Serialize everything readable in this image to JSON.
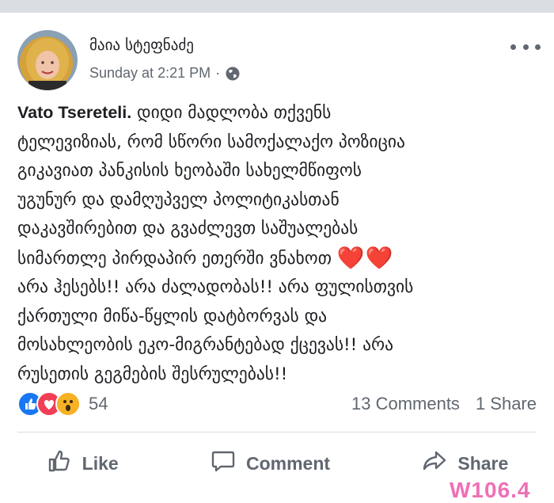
{
  "post": {
    "author": "მაია სტეფნაძე",
    "timestamp": "Sunday at 2:21 PM",
    "separator": "·",
    "privacy_icon": "globe-icon",
    "text_name": "Vato Tsereteli.",
    "text_body": " დიდი მადლობა თქვენს\nტელევიზიას, რომ სწორი სამოქალაქო პოზიცია\nგიკავიათ პანკისის ხეობაში სახელმწიფოს\nუგუნურ და დამღუპველ პოლიტიკასთან\nდაკავშირებით და გვაძლევთ საშუალებას\nსიმართლე პირდაპირ ეთერში ვნახოთ ",
    "text_emoji": "❤️❤️",
    "text_end": "\nარა ჰესებს!! არა ძალადობას!! არა ფულისთვის\nქართული მიწა-წყლის დატბორვას და\nმოსახლეობის ეკო-მიგრანტებად ქცევას!! არა\nრუსეთის გეგმების შესრულებას!!"
  },
  "reactions": {
    "types": [
      "like-icon",
      "love-icon",
      "wow-icon"
    ],
    "count": "54"
  },
  "stats": {
    "comments": "13 Comments",
    "shares": "1 Share"
  },
  "actions": {
    "like": "Like",
    "comment": "Comment",
    "share": "Share"
  },
  "watermark": "W106.4",
  "colors": {
    "accent": "#1877f2",
    "love": "#f33e58",
    "wow": "#f7b125",
    "muted": "#606770",
    "watermark": "#f06fb5"
  }
}
